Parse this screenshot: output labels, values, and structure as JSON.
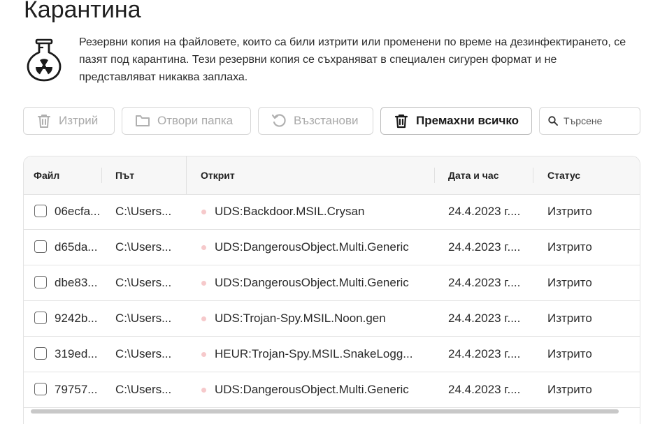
{
  "page": {
    "title": "Карантина",
    "description": "Резервни копия на файловете, които са били изтрити или променени по време на дезинфектирането, се пазят под карантина. Тези резервни копия се съхраняват в специален сигурен формат и не представляват никаква заплаха."
  },
  "toolbar": {
    "delete_label": "Изтрий",
    "open_folder_label": "Отвори папка",
    "restore_label": "Възстанови",
    "remove_all_label": "Премахни всичко",
    "search_placeholder": "Търсене",
    "search_value": ""
  },
  "table": {
    "columns": [
      "Файл",
      "Път",
      "Открит",
      "Дата и час",
      "Статус"
    ],
    "rows": [
      {
        "file": "06ecfa...",
        "path": "C:\\Users...",
        "detected": "UDS:Backdoor.MSIL.Crysan",
        "datetime": "24.4.2023 г....",
        "status": "Изтрито"
      },
      {
        "file": "d65da...",
        "path": "C:\\Users...",
        "detected": "UDS:DangerousObject.Multi.Generic",
        "datetime": "24.4.2023 г....",
        "status": "Изтрито"
      },
      {
        "file": "dbe83...",
        "path": "C:\\Users...",
        "detected": "UDS:DangerousObject.Multi.Generic",
        "datetime": "24.4.2023 г....",
        "status": "Изтрито"
      },
      {
        "file": "9242b...",
        "path": "C:\\Users...",
        "detected": "UDS:Trojan-Spy.MSIL.Noon.gen",
        "datetime": "24.4.2023 г....",
        "status": "Изтрито"
      },
      {
        "file": "319ed...",
        "path": "C:\\Users...",
        "detected": "HEUR:Trojan-Spy.MSIL.SnakeLogg...",
        "datetime": "24.4.2023 г....",
        "status": "Изтрито"
      },
      {
        "file": "79757...",
        "path": "C:\\Users...",
        "detected": "UDS:DangerousObject.Multi.Generic",
        "datetime": "24.4.2023 г....",
        "status": "Изтрито"
      }
    ]
  },
  "icons": {
    "intro": "quarantine-flask-icon",
    "delete": "trash-icon",
    "open_folder": "folder-icon",
    "restore": "restore-icon",
    "remove_all": "trash-icon",
    "search": "search-icon",
    "threat_marker": "threat-dot-icon"
  },
  "colors": {
    "disabled_text": "#a9a9a9",
    "threat_dot": "#f6c9cb",
    "header_bg": "#f7f7f7"
  }
}
